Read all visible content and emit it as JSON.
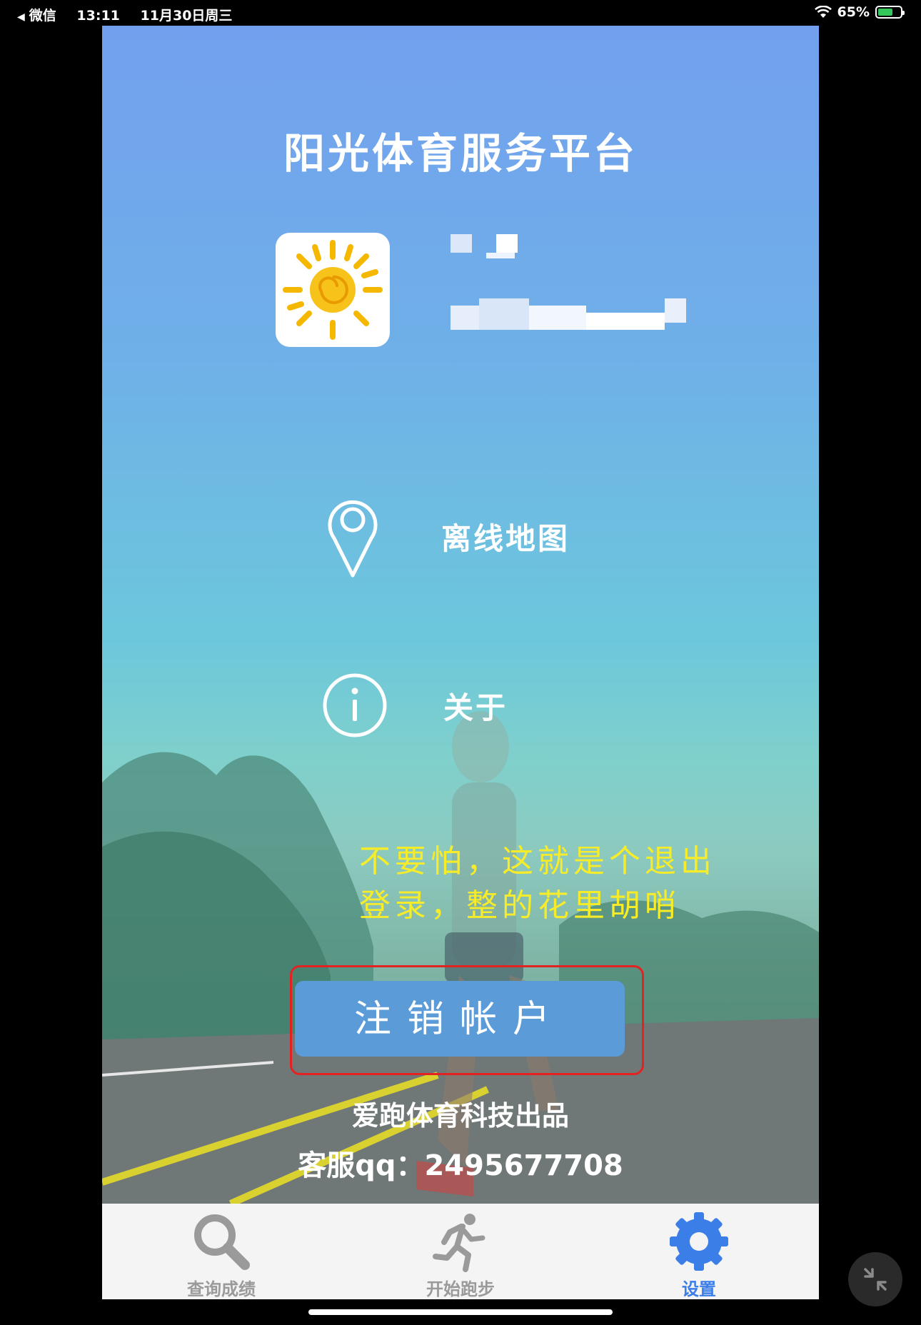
{
  "status_bar": {
    "back_app": "微信",
    "time": "13:11",
    "date": "11月30日周三",
    "battery": "65%",
    "battery_level": 0.65
  },
  "app": {
    "title": "阳光体育服务平台",
    "menu": [
      {
        "label": "离线地图",
        "icon": "location-pin-icon"
      },
      {
        "label": "关于",
        "icon": "info-icon"
      }
    ],
    "annotation_note": [
      "不要怕，这就是个退出",
      "登录，整的花里胡哨"
    ],
    "logout_button": "注销帐户",
    "credit": "爱跑体育科技出品",
    "support": "客服qq：2495677708"
  },
  "tab_bar": {
    "tabs": [
      {
        "label": "查询成绩",
        "icon": "search-icon",
        "active": false
      },
      {
        "label": "开始跑步",
        "icon": "runner-icon",
        "active": false
      },
      {
        "label": "设置",
        "icon": "gear-icon",
        "active": true
      }
    ]
  },
  "colors": {
    "accent": "#3b7ee8",
    "button": "#5b9bd8",
    "note_text": "#f6ec2a",
    "highlight": "#e52222"
  }
}
